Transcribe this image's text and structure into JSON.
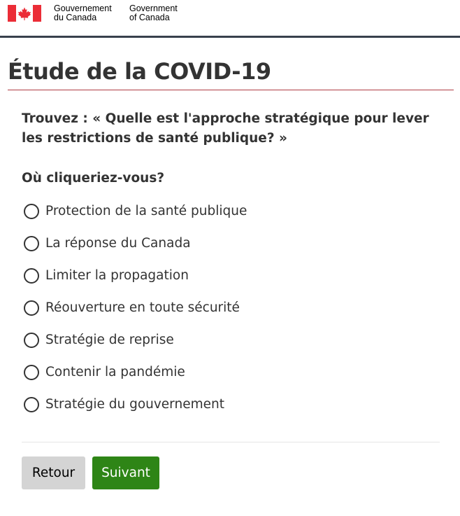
{
  "header": {
    "gov_fr_line1": "Gouvernement",
    "gov_fr_line2": "du Canada",
    "gov_en_line1": "Government",
    "gov_en_line2": "of Canada",
    "flag_icon": "canada-flag-icon",
    "flag_color": "#eb2d37",
    "rule_color": "#38414d"
  },
  "main": {
    "title": "Étude de la COVID-19",
    "title_rule_color": "#af3c43",
    "question": "Trouvez : « Quelle est l'approche stratégique pour lever les restrictions de santé publique? »",
    "prompt": "Où cliqueriez-vous?",
    "options": [
      {
        "label": "Protection de la santé publique"
      },
      {
        "label": "La réponse du Canada"
      },
      {
        "label": "Limiter la propagation"
      },
      {
        "label": "Réouverture en toute sécurité"
      },
      {
        "label": "Stratégie de reprise"
      },
      {
        "label": "Contenir la pandémie"
      },
      {
        "label": "Stratégie du gouvernement"
      }
    ]
  },
  "buttons": {
    "back_label": "Retour",
    "back_color": "#d4d4d4",
    "next_label": "Suivant",
    "next_color": "#2e8516"
  }
}
